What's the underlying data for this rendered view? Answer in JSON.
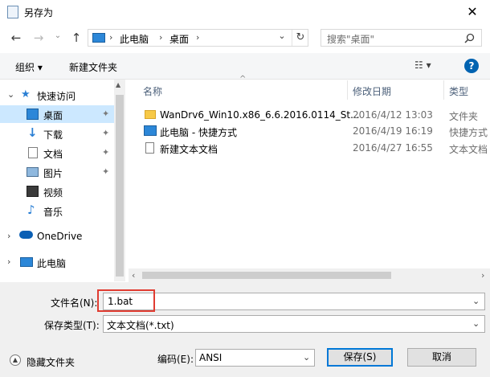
{
  "window": {
    "title": "另存为",
    "close_glyph": "✕"
  },
  "nav": {
    "back_glyph": "←",
    "forward_glyph": "→",
    "recent_glyph": "⌄",
    "up_glyph": "↑",
    "breadcrumb": [
      "此电脑",
      "桌面"
    ],
    "separator": "›",
    "refresh_glyph": "↻",
    "search_placeholder": "搜索\"桌面\""
  },
  "toolbar": {
    "organize_label": "组织 ▾",
    "new_folder_label": "新建文件夹",
    "view_glyph": "☷ ▾",
    "help_glyph": "?"
  },
  "sidebar": {
    "quick_access": "快速访问",
    "items": [
      {
        "label": "桌面",
        "pinned": true,
        "selected": true
      },
      {
        "label": "下载",
        "pinned": true
      },
      {
        "label": "文档",
        "pinned": true
      },
      {
        "label": "图片",
        "pinned": true
      },
      {
        "label": "视频"
      },
      {
        "label": "音乐"
      }
    ],
    "onedrive": "OneDrive",
    "this_pc": "此电脑",
    "pin_glyph": "📌"
  },
  "columns": {
    "name": "名称",
    "modified": "修改日期",
    "type": "类型",
    "sort_glyph": "^"
  },
  "files": [
    {
      "name": "WanDrv6_Win10.x86_6.6.2016.0114_St...",
      "modified": "2016/4/12 13:03",
      "type": "文件夹"
    },
    {
      "name": "此电脑 - 快捷方式",
      "modified": "2016/4/19 16:19",
      "type": "快捷方式"
    },
    {
      "name": "新建文本文档",
      "modified": "2016/4/27 16:55",
      "type": "文本文档"
    }
  ],
  "form": {
    "filename_label": "文件名(N):",
    "filename_value": "1.bat",
    "filetype_label": "保存类型(T):",
    "filetype_value": "文本文档(*.txt)",
    "hide_folders_label": "隐藏文件夹",
    "encoding_label": "编码(E):",
    "encoding_value": "ANSI",
    "save_label": "保存(S)",
    "cancel_label": "取消",
    "dropdown_glyph": "⌄"
  },
  "colors": {
    "selection": "#cce8ff",
    "highlight_border": "#e03c31",
    "folder": "#f7c948",
    "accent": "#0063b1"
  }
}
